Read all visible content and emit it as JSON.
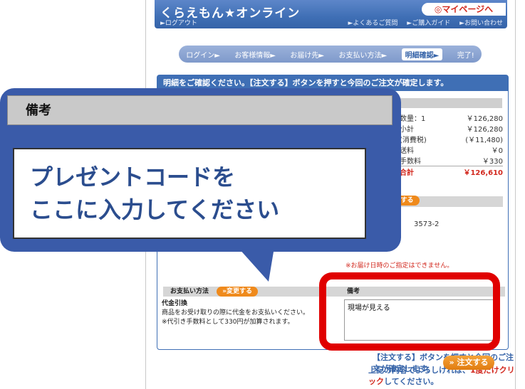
{
  "header": {
    "brand": "くらえもん★オンライン",
    "logout": "►ログアウト",
    "mypage": "◎マイページへ",
    "links": [
      "►よくあるご質問",
      "►ご購入ガイド",
      "►お問い合わせ"
    ]
  },
  "steps": [
    "ログイン►",
    "お客様情報►",
    "お届け先►",
    "お支払い方法►",
    "明細確認►",
    "完了!"
  ],
  "panel": {
    "heading": "明細をご確認ください。【注文する】ボタンを押すと今回のご注文が確定します。"
  },
  "order_summary": {
    "quantity_label": "数量：1",
    "quantity_price": "￥126,280",
    "rows": [
      {
        "label": "小計",
        "value": "￥126,280"
      },
      {
        "label": "(消費税)",
        "value": "(￥11,480)"
      },
      {
        "label": "送料",
        "value": "￥0"
      },
      {
        "label": "手数料",
        "value": "￥330"
      }
    ],
    "total_label": "合計",
    "total_value": "￥126,610"
  },
  "delivery": {
    "change_pill": "する",
    "zip_fragment": "3573-2",
    "no_date_note": "※お届け日時のご指定はできません。"
  },
  "payment": {
    "heading": "お支払い方法",
    "change_button": "»変更する",
    "method": "代金引換",
    "line1": "商品をお受け取りの際に代金をお支払いください。",
    "line2": "※代引き手数料として330円が加算されます。"
  },
  "remarks": {
    "heading": "備考",
    "value": "現場が見える"
  },
  "confirm": {
    "line1": "【注文する】ボタンを押すと今回のご注文が確定します。",
    "line2_pre": "上記の内容でよろしければ、",
    "line2_emph": "1度だけクリック",
    "line2_post": "してください。",
    "order_button": "» 注文する"
  },
  "callout": {
    "heading": "備考",
    "text_line1": "プレゼントコードを",
    "text_line2": "ここに入力してください"
  },
  "colors": {
    "brand_blue": "#3f6fb5",
    "callout_blue": "#3a5ba9",
    "highlight_red": "#e00000",
    "order_orange": "#ef8a1c"
  }
}
